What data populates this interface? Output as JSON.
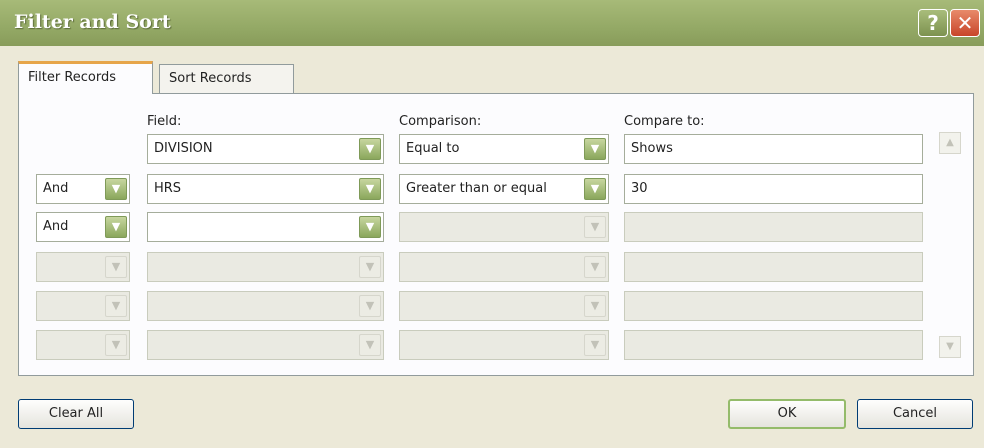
{
  "window": {
    "title": "Filter and Sort",
    "help_glyph": "?",
    "close_glyph": "✕"
  },
  "tabs": [
    {
      "label": "Filter Records",
      "active": true
    },
    {
      "label": "Sort Records",
      "active": false
    }
  ],
  "headers": {
    "field": "Field:",
    "comparison": "Comparison:",
    "compare_to": "Compare to:"
  },
  "rows": [
    {
      "connector": "",
      "field": "DIVISION",
      "comparison": "Equal to",
      "compare_to": "Shows",
      "enabled": true
    },
    {
      "connector": "And",
      "field": "HRS",
      "comparison": "Greater than or equal",
      "compare_to": "30",
      "enabled": true
    },
    {
      "connector": "And",
      "field": "",
      "comparison": "",
      "compare_to": "",
      "enabled": true
    },
    {
      "connector": "",
      "field": "",
      "comparison": "",
      "compare_to": "",
      "enabled": false
    },
    {
      "connector": "",
      "field": "",
      "comparison": "",
      "compare_to": "",
      "enabled": false
    },
    {
      "connector": "",
      "field": "",
      "comparison": "",
      "compare_to": "",
      "enabled": false
    }
  ],
  "buttons": {
    "clear_all": "Clear All",
    "ok": "OK",
    "cancel": "Cancel"
  },
  "icons": {
    "dropdown": "chevron-down-icon",
    "scroll_up": "scroll-up-icon",
    "scroll_down": "scroll-down-icon"
  }
}
